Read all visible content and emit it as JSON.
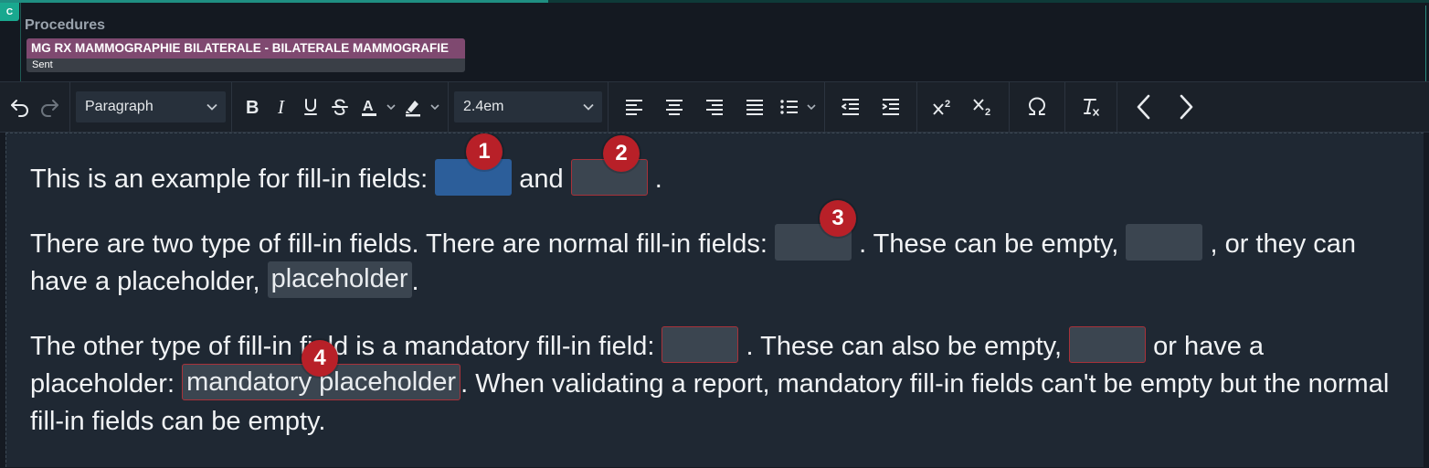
{
  "header": {
    "badge": "C",
    "title": "Procedures",
    "procedure": {
      "name": "MG RX MAMMOGRAPHIE BILATERALE - BILATERALE MAMMOGRAFIE",
      "status": "Sent"
    }
  },
  "toolbar": {
    "block_format": "Paragraph",
    "font_size": "2.4em",
    "icons": [
      "undo-icon",
      "redo-icon",
      "bold-icon",
      "italic-icon",
      "underline-icon",
      "strikethrough-icon",
      "text-color-icon",
      "highlight-color-icon",
      "align-left-icon",
      "align-center-icon",
      "align-right-icon",
      "justify-icon",
      "bullet-list-icon",
      "outdent-icon",
      "indent-icon",
      "superscript-icon",
      "subscript-icon",
      "omega-icon",
      "clear-formatting-icon",
      "chevron-left-icon",
      "chevron-right-icon"
    ]
  },
  "editor": {
    "p1": {
      "part1": "This is an example for fill-in fields: ",
      "part2": " and ",
      "part3": " ."
    },
    "p2": {
      "part1": "There are two type of fill-in fields. There are normal fill-in fields: ",
      "part2": " . These can be empty, ",
      "part3": " , or they can have a placeholder, ",
      "placeholder": "placeholder",
      "part4": "."
    },
    "p3": {
      "part1": "The other type of fill-in field is a mandatory fill-in field: ",
      "part2": " . These can also be empty, ",
      "part3": " or have a placeholder: ",
      "placeholder": "mandatory placeholder",
      "part4": ". When validating a report, mandatory fill-in fields can't be empty but the normal fill-in fields can be empty."
    }
  },
  "markers": [
    "1",
    "2",
    "3",
    "4"
  ],
  "colors": {
    "marker": "#b82028",
    "active_field": "#2c5e9a",
    "normal_field": "#3b4550",
    "mandatory_border": "#a8323a",
    "procedure_tag": "#7f4970"
  }
}
